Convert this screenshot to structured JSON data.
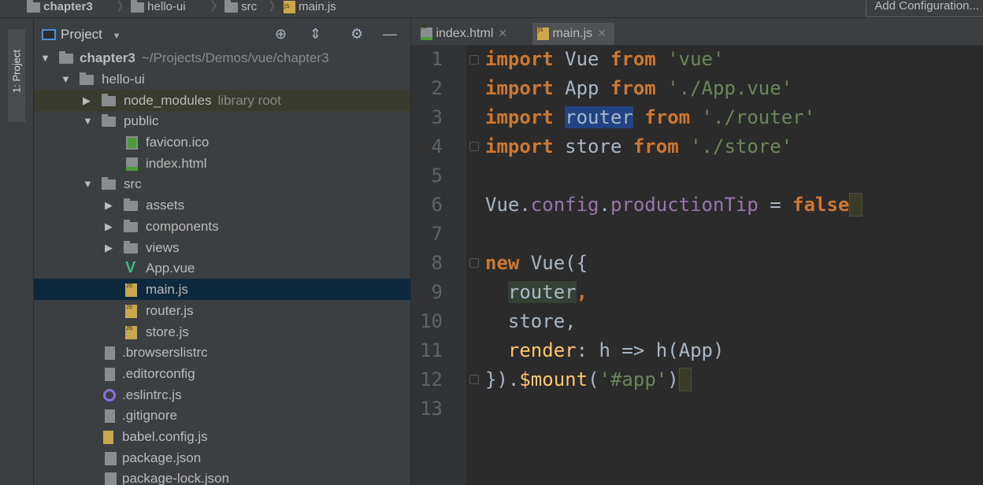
{
  "navbar": {
    "crumbs": [
      "chapter3",
      "hello-ui",
      "src",
      "main.js"
    ],
    "add_config": "Add Configuration..."
  },
  "toolstrip": {
    "project_tab": "1: Project"
  },
  "project_panel": {
    "title": "Project",
    "tree": [
      {
        "label": "chapter3",
        "hint": "~/Projects/Demos/vue/chapter3",
        "type": "folder",
        "expanded": true
      },
      {
        "label": "hello-ui",
        "type": "folder",
        "expanded": true
      },
      {
        "label": "node_modules",
        "hint": "library root",
        "type": "folder",
        "expanded": false
      },
      {
        "label": "public",
        "type": "folder",
        "expanded": true
      },
      {
        "label": "favicon.ico",
        "type": "ico"
      },
      {
        "label": "index.html",
        "type": "html"
      },
      {
        "label": "src",
        "type": "folder",
        "expanded": true
      },
      {
        "label": "assets",
        "type": "folder",
        "expanded": false
      },
      {
        "label": "components",
        "type": "folder",
        "expanded": false
      },
      {
        "label": "views",
        "type": "folder",
        "expanded": false
      },
      {
        "label": "App.vue",
        "type": "vue"
      },
      {
        "label": "main.js",
        "type": "js",
        "selected": true
      },
      {
        "label": "router.js",
        "type": "js"
      },
      {
        "label": "store.js",
        "type": "js"
      },
      {
        "label": ".browserslistrc",
        "type": "file"
      },
      {
        "label": ".editorconfig",
        "type": "file"
      },
      {
        "label": ".eslintrc.js",
        "type": "eslint"
      },
      {
        "label": ".gitignore",
        "type": "file"
      },
      {
        "label": "babel.config.js",
        "type": "file"
      },
      {
        "label": "package.json",
        "type": "json"
      },
      {
        "label": "package-lock.json",
        "type": "json"
      }
    ]
  },
  "editor": {
    "tabs": [
      {
        "label": "index.html",
        "active": false
      },
      {
        "label": "main.js",
        "active": true
      }
    ],
    "line_numbers": [
      "1",
      "2",
      "3",
      "4",
      "5",
      "6",
      "7",
      "8",
      "9",
      "10",
      "11",
      "12",
      "13"
    ],
    "code": {
      "l1": {
        "k": "import",
        "a": " Vue ",
        "k2": "from",
        "s": " 'vue'"
      },
      "l2": {
        "k": "import",
        "a": " App ",
        "k2": "from",
        "s": " './App.vue'"
      },
      "l3": {
        "k": "import",
        "w": "router",
        "k2": "from",
        "s": " './router'"
      },
      "l4": {
        "k": "import",
        "a": " store ",
        "k2": "from",
        "s": " './store'"
      },
      "l6": {
        "a": "Vue.",
        "p1": "config",
        "d": ".",
        "p2": "productionTip",
        "e": " = ",
        "k": "false"
      },
      "l8": {
        "k": "new",
        "a": " Vue({"
      },
      "l9": {
        "w": "router",
        "a": ","
      },
      "l10": {
        "a": "store,"
      },
      "l11": {
        "f": "render",
        "a": ": h => h(App)"
      },
      "l12": {
        "a": "}).",
        "f": "$mount",
        "a2": "(",
        "s": "'#app'",
        "a3": ")"
      }
    }
  }
}
